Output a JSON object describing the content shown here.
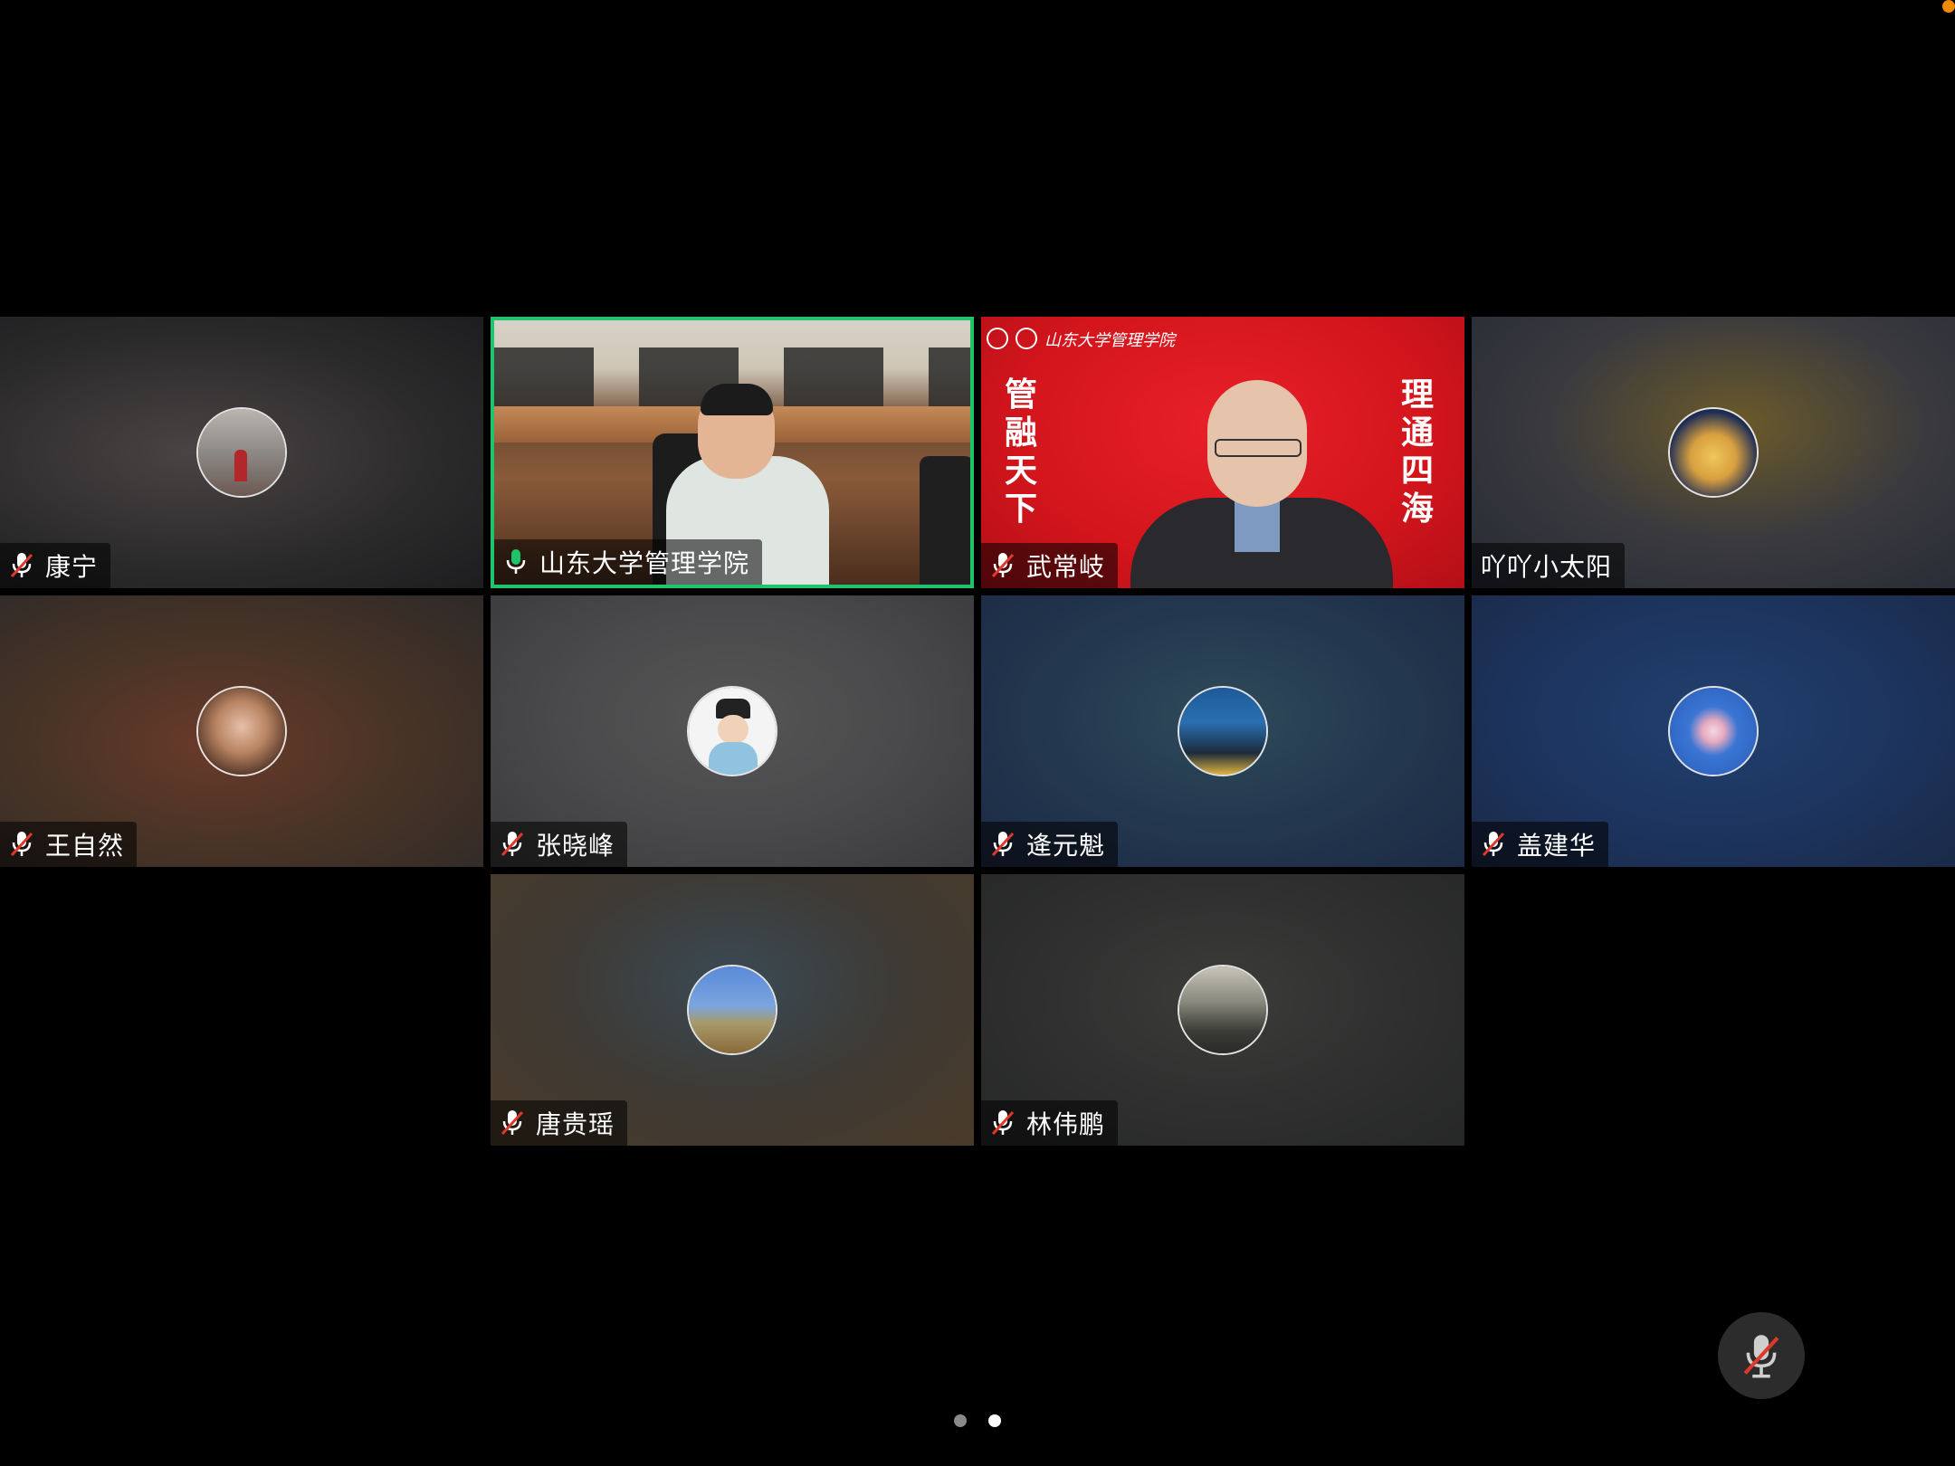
{
  "participants": [
    {
      "name": "康宁",
      "mic": "muted"
    },
    {
      "name": "山东大学管理学院",
      "mic": "active"
    },
    {
      "name": "武常岐",
      "mic": "muted"
    },
    {
      "name": "吖吖小太阳",
      "mic": "none"
    },
    {
      "name": "王自然",
      "mic": "muted"
    },
    {
      "name": "张晓峰",
      "mic": "muted"
    },
    {
      "name": "逄元魁",
      "mic": "muted"
    },
    {
      "name": "盖建华",
      "mic": "muted"
    },
    {
      "name": "唐贵瑶",
      "mic": "muted"
    },
    {
      "name": "林伟鹏",
      "mic": "muted"
    }
  ],
  "banner": {
    "left_text": "管融天下",
    "right_text": "理通四海",
    "logo_text": "山东大学管理学院"
  },
  "pagination": {
    "pages": 2,
    "current": 2
  },
  "colors": {
    "active_speaker": "#1ec46a",
    "muted_icon": "#e0392c",
    "banner_red": "#d3151c",
    "corner_indicator": "#f08a00"
  },
  "icons": {
    "mute_button": "microphone-muted-icon"
  }
}
